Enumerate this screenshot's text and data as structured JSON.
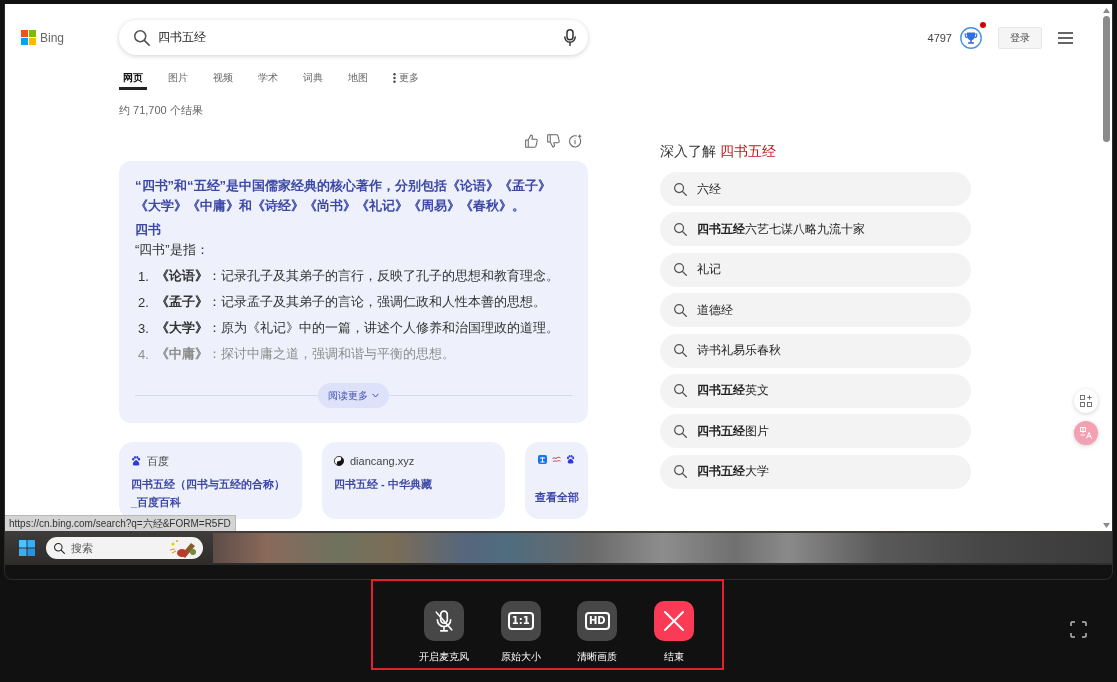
{
  "screen": {
    "page": {
      "logo": {
        "text": "Bing"
      },
      "search": {
        "value": "四书五经"
      },
      "account": {
        "points": "4797",
        "notification": true,
        "sign_in": "登录"
      },
      "tabs": [
        {
          "label": "网页",
          "selected": true,
          "kind": "tab"
        },
        {
          "label": "图片",
          "selected": false,
          "kind": "tab"
        },
        {
          "label": "视频",
          "selected": false,
          "kind": "tab"
        },
        {
          "label": "学术",
          "selected": false,
          "kind": "tab"
        },
        {
          "label": "词典",
          "selected": false,
          "kind": "tab"
        },
        {
          "label": "地图",
          "selected": false,
          "kind": "tab"
        },
        {
          "label": "更多",
          "selected": false,
          "kind": "more"
        }
      ],
      "result_count": "约 71,700 个结果",
      "answer": {
        "title": "“四书”和“五经”是中国儒家经典的核心著作，分别包括《论语》《孟子》《大学》《中庸》和《诗经》《尚书》《礼记》《周易》《春秋》。",
        "section": "四书",
        "intro": "“四书”是指：",
        "items": [
          {
            "number": "1.",
            "text": "**《论语》**：记录孔子及其弟子的言行，反映了孔子的思想和教育理念。",
            "faded": false
          },
          {
            "number": "2.",
            "text": "**《孟子》**：记录孟子及其弟子的言论，强调仁政和人性本善的思想。",
            "faded": false
          },
          {
            "number": "3.",
            "text": "**《大学》**：原为《礼记》中的一篇，讲述个人修养和治国理政的道理。",
            "faded": false
          },
          {
            "number": "4.",
            "text": "**《中庸》**：探讨中庸之道，强调和谐与平衡的思想。",
            "faded": true
          }
        ],
        "read_more": "阅读更多"
      },
      "sources": [
        {
          "kind": "site",
          "site": "百度",
          "title": "四书五经（四书与五经的合称）_百度百科"
        },
        {
          "kind": "site",
          "site": "diancang.xyz",
          "title": "四书五经 - 中华典藏"
        },
        {
          "kind": "all",
          "label": "查看全部"
        }
      ],
      "related": {
        "heading": "深入了解",
        "query": "四书五经",
        "items": [
          "六经",
          "**四书五经**六艺七谋八略九流十家",
          "礼记",
          "道德经",
          "诗书礼易乐春秋",
          "**四书五经**英文",
          "**四书五经**图片",
          "**四书五经**大学"
        ]
      },
      "status_url": "https://cn.bing.com/search?q=六经&FORM=R5FD"
    },
    "taskbar": {
      "search": {
        "placeholder": "搜索"
      }
    }
  },
  "controls": [
    {
      "kind": "mic_off",
      "label": "开启麦克风"
    },
    {
      "kind": "ratio",
      "icon_text": "1:1",
      "label": "原始大小"
    },
    {
      "kind": "hd",
      "icon_text": "HD",
      "label": "清晰画质"
    },
    {
      "kind": "end",
      "label": "结束"
    }
  ]
}
